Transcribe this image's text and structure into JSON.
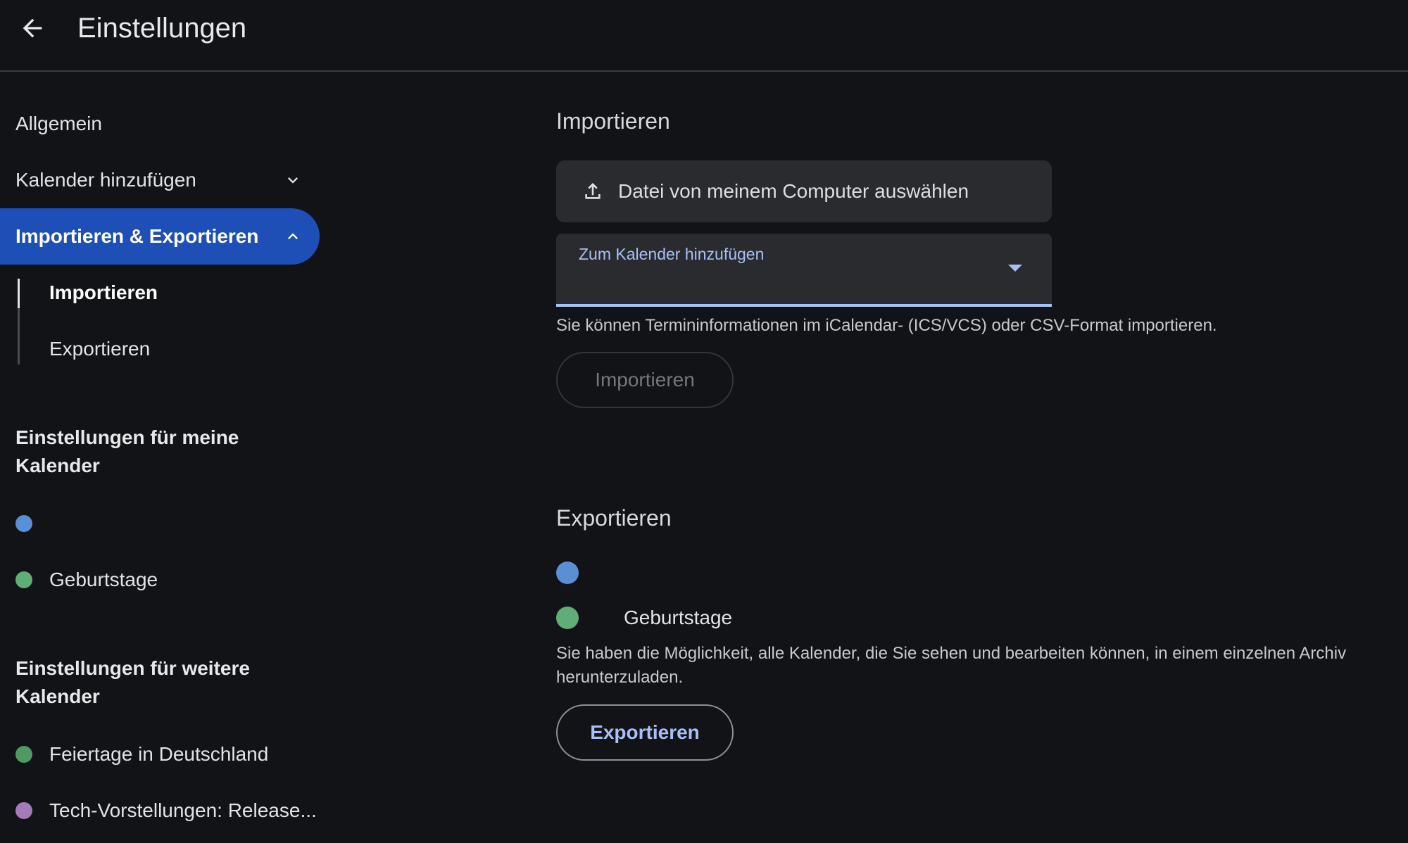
{
  "header": {
    "title": "Einstellungen",
    "back_icon": "arrow-left-icon"
  },
  "sidebar": {
    "general": "Allgemein",
    "add_calendar": "Kalender hinzufügen",
    "import_export": "Importieren & Exportieren",
    "sub_items": [
      "Importieren",
      "Exportieren"
    ],
    "my_calendars_heading": "Einstellungen für meine Kalender",
    "my_calendars": [
      {
        "label": "",
        "color": "#5a8fd6"
      },
      {
        "label": "Geburtstage",
        "color": "#5fae78"
      }
    ],
    "other_calendars_heading": "Einstellungen für weitere Kalender",
    "other_calendars": [
      {
        "label": "Feiertage in Deutschland",
        "color": "#4f9a62"
      },
      {
        "label": "Tech-Vorstellungen: Release...",
        "color": "#a37bb8"
      }
    ]
  },
  "import": {
    "title": "Importieren",
    "file_button": "Datei von meinem Computer auswählen",
    "select_label": "Zum Kalender hinzufügen",
    "helper": "Sie können Termininformationen im iCalendar- (ICS/VCS) oder CSV-Format importieren.",
    "button": "Importieren"
  },
  "export": {
    "title": "Exportieren",
    "calendars": [
      {
        "label": "",
        "color": "#5a8fd6"
      },
      {
        "label": "Geburtstage",
        "color": "#5fae78"
      }
    ],
    "helper": "Sie haben die Möglichkeit, alle Kalender, die Sie sehen und bearbeiten können, in einem einzelnen Archiv herunterzuladen.",
    "button": "Exportieren"
  },
  "colors": {
    "background": "#121316",
    "accent": "#1e4fb6",
    "link": "#a8c0f5"
  }
}
